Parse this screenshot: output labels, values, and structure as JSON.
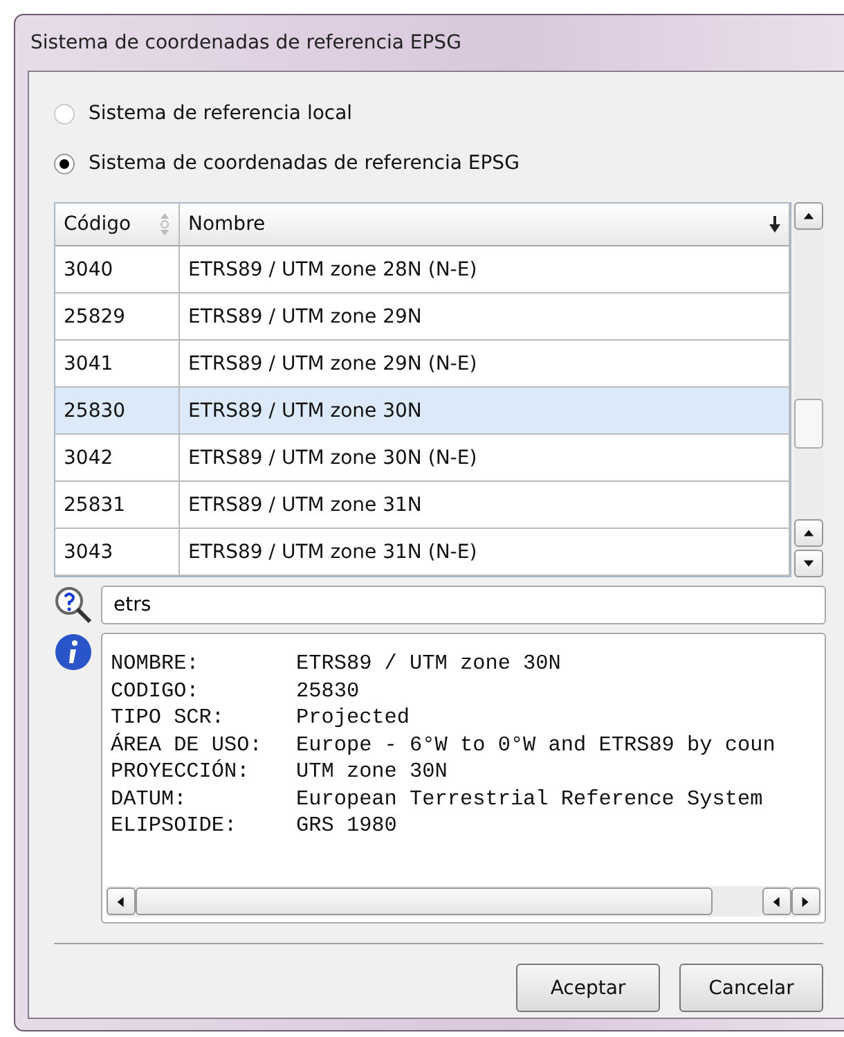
{
  "window": {
    "title": "Sistema de coordenadas de referencia EPSG"
  },
  "options": [
    {
      "label": "Sistema de referencia local",
      "selected": false
    },
    {
      "label": "Sistema de coordenadas de referencia EPSG",
      "selected": true
    }
  ],
  "table": {
    "columns": [
      "Código",
      "Nombre"
    ],
    "rows": [
      {
        "code": "3040",
        "name": "ETRS89 / UTM zone 28N (N-E)",
        "selected": false
      },
      {
        "code": "25829",
        "name": "ETRS89 / UTM zone 29N",
        "selected": false
      },
      {
        "code": "3041",
        "name": "ETRS89 / UTM zone 29N (N-E)",
        "selected": false
      },
      {
        "code": "25830",
        "name": "ETRS89 / UTM zone 30N",
        "selected": true
      },
      {
        "code": "3042",
        "name": "ETRS89 / UTM zone 30N (N-E)",
        "selected": false
      },
      {
        "code": "25831",
        "name": "ETRS89 / UTM zone 31N",
        "selected": false
      },
      {
        "code": "3043",
        "name": "ETRS89 / UTM zone 31N (N-E)",
        "selected": false
      }
    ]
  },
  "search": {
    "value": "etrs"
  },
  "info": [
    {
      "label": "NOMBRE:",
      "value": "ETRS89 / UTM zone 30N"
    },
    {
      "label": "CODIGO:",
      "value": "25830"
    },
    {
      "label": "TIPO SCR:",
      "value": "Projected"
    },
    {
      "label": "ÁREA DE USO:",
      "value": "Europe - 6°W to 0°W and ETRS89 by coun"
    },
    {
      "label": "PROYECCIÓN:",
      "value": "UTM zone 30N"
    },
    {
      "label": "DATUM:",
      "value": "European Terrestrial Reference System"
    },
    {
      "label": "ELIPSOIDE:",
      "value": "GRS 1980"
    }
  ],
  "buttons": [
    "Aceptar",
    "Cancelar"
  ]
}
